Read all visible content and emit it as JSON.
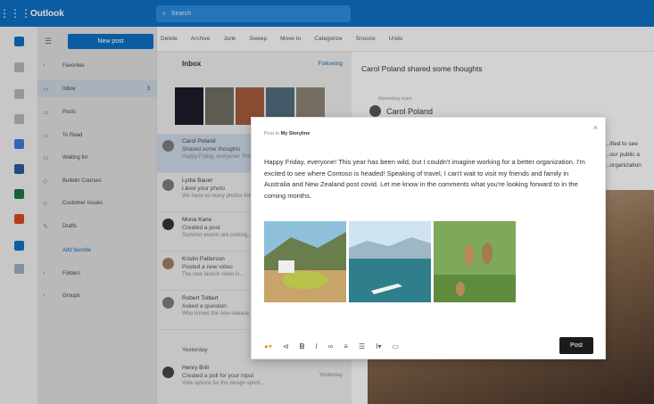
{
  "topbar": {
    "app_name": "Outlook",
    "search_placeholder": "Search"
  },
  "rail": {
    "icons": [
      "mail-icon",
      "calendar-icon",
      "people-icon",
      "attach-icon",
      "todo-icon",
      "word-icon",
      "excel-icon",
      "powerpoint-icon",
      "yammer-icon",
      "onedrive-icon"
    ]
  },
  "folders": {
    "new_mail_label": "New post",
    "items": [
      {
        "label": "Favorites",
        "icon": "chevron-icon"
      },
      {
        "label": "Inbox",
        "icon": "inbox-icon",
        "count": "3"
      },
      {
        "label": "Posts",
        "icon": "posts-icon"
      },
      {
        "label": "To Read",
        "icon": "read-icon"
      },
      {
        "label": "Waiting for",
        "icon": "clock-icon"
      },
      {
        "label": "Bulletin Courses",
        "icon": "tag-icon"
      },
      {
        "label": "Customer Issues",
        "icon": "tag-icon"
      },
      {
        "label": "Drafts",
        "icon": "draft-icon"
      },
      {
        "label": "Add favorite",
        "icon": ""
      },
      {
        "label": "Folders",
        "icon": "chevron-icon"
      },
      {
        "label": "Groups",
        "icon": "chevron-icon"
      }
    ]
  },
  "toolbar": {
    "items": [
      "Delete",
      "Archive",
      "Junk",
      "Sweep",
      "Move to",
      "Categorize",
      "Snooze",
      "Undo"
    ]
  },
  "msglist": {
    "title": "Inbox",
    "filter": "Following",
    "messages": [
      {
        "name": "Carol Poland",
        "subject": "Shared some thoughts",
        "preview": "Happy Friday, everyone! This year...",
        "time": ""
      },
      {
        "name": "Lydia Bauer",
        "subject": "Liked your photo",
        "preview": "We have so many photos from...",
        "time": ""
      },
      {
        "name": "Mona Kane",
        "subject": "Created a post",
        "preview": "Summer events are coming...",
        "time": ""
      },
      {
        "name": "Kristin Patterson",
        "subject": "Posted a new video",
        "preview": "The new launch video is...",
        "time": ""
      },
      {
        "name": "Robert Tolbert",
        "subject": "Asked a question",
        "preview": "Who knows the new release...",
        "time": ""
      }
    ],
    "section": "Yesterday",
    "last": {
      "name": "Henry Brill",
      "subject": "Created a poll for your input",
      "preview": "Vote options for the design sprint...",
      "time": "Yesterday"
    }
  },
  "reading": {
    "title": "Carol Poland shared some thoughts",
    "group": "Marketing team",
    "author": "Carol Poland",
    "side_text": [
      "...ified to see",
      "...our public a",
      "...organization"
    ]
  },
  "dialog": {
    "post_to_prefix": "Post to",
    "post_to_group": "My Storyline",
    "body": "Happy Friday, everyone! This year has been wild, but I couldn't imagine working for a better organization. I'm excited to see where Contoso is headed! Speaking of travel, I can't wait to visit my friends and family in Australia and New Zealand post covid. Let me know in the comments what you're looking forward to in the coming months.",
    "post_label": "Post",
    "close_glyph": "×"
  }
}
